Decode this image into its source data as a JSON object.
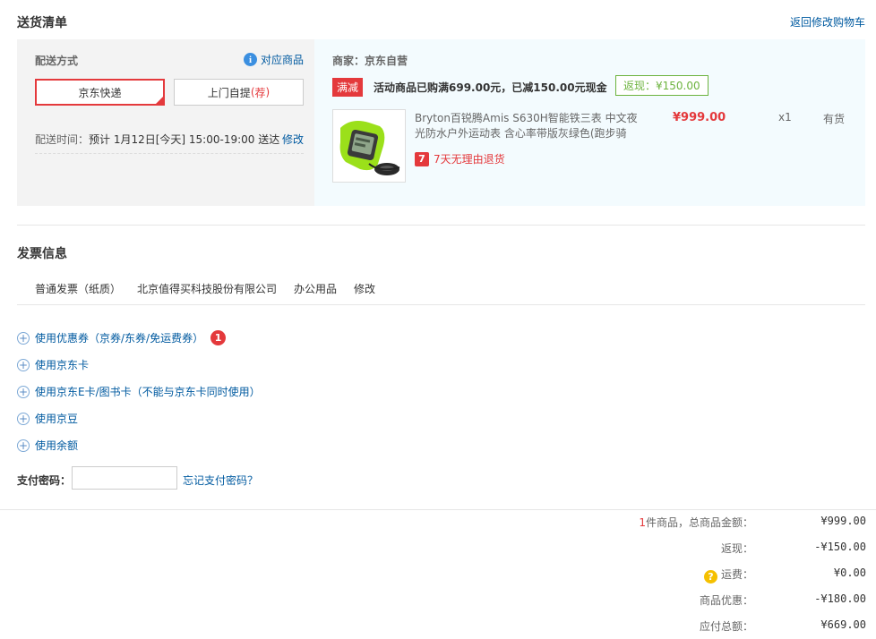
{
  "delivery": {
    "title": "送货清单",
    "back_link": "返回修改购物车",
    "method_label": "配送方式",
    "corr_goods": "对应商品",
    "options": [
      {
        "label": "京东快递",
        "selected": true
      },
      {
        "label": "上门自提",
        "suffix": "荐",
        "selected": false
      }
    ],
    "time_label": "配送时间：",
    "time_value": "预计 1月12日[今天] 15:00-19:00 送达",
    "time_edit": "修改",
    "seller": "商家：京东自营",
    "promo_tag": "满减",
    "promo_text": "活动商品已购满699.00元，已减150.00元现金",
    "cashback_tag": "返现：¥150.00",
    "product": {
      "name": "Bryton百锐腾Amis S630H智能铁三表 中文夜光防水户外运动表 含心率带版灰绿色(跑步骑",
      "price": "¥999.00",
      "qty": "x1",
      "stock": "有货",
      "return_policy": "7天无理由退货",
      "return_icon": "7"
    }
  },
  "invoice": {
    "title": "发票信息",
    "type": "普通发票（纸质）",
    "company": "北京值得买科技股份有限公司",
    "content": "办公用品",
    "edit": "修改"
  },
  "payment": {
    "options": [
      {
        "label": "使用优惠券（京券/东券/免运费券）",
        "badge": "1"
      },
      {
        "label": "使用京东卡"
      },
      {
        "label": "使用京东E卡/图书卡（不能与京东卡同时使用）"
      },
      {
        "label": "使用京豆"
      },
      {
        "label": "使用余额"
      }
    ],
    "password_label": "支付密码：",
    "forgot_password": "忘记支付密码？"
  },
  "summary": {
    "count": "1",
    "count_suffix": "件商品，总商品金额：",
    "total_value": "¥999.00",
    "cashback_label": "返现：",
    "cashback_value": "-¥150.00",
    "shipping_label": "运费：",
    "shipping_value": "¥0.00",
    "discount_label": "商品优惠：",
    "discount_value": "-¥180.00",
    "payable_label": "应付总额：",
    "payable_value": "¥669.00"
  },
  "colors": {
    "accent": "#e4393c",
    "link": "#005aa0",
    "cashback": "#6cb33e"
  }
}
